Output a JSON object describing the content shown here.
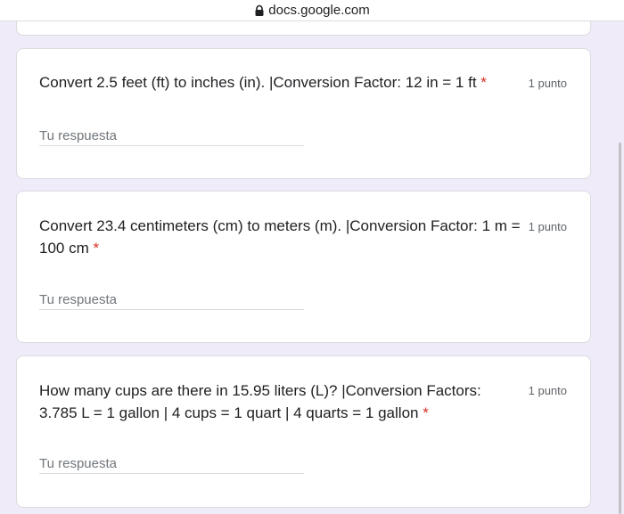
{
  "browser": {
    "url": "docs.google.com"
  },
  "questions": [
    {
      "title": "Convert 2.5 feet (ft) to inches (in). |Conversion Factor: 12 in = 1 ft",
      "required_mark": "*",
      "points": "1 punto",
      "answer_placeholder": "Tu respuesta"
    },
    {
      "title": "Convert 23.4 centimeters (cm) to meters (m). |Conversion Factor: 1 m = 100 cm",
      "required_mark": "*",
      "points": "1 punto",
      "answer_placeholder": "Tu respuesta"
    },
    {
      "title": "How many cups are there in 15.95 liters (L)? |Conversion Factors: 3.785 L = 1 gallon | 4 cups = 1 quart | 4 quarts = 1 gallon",
      "required_mark": "*",
      "points": "1 punto",
      "answer_placeholder": "Tu respuesta"
    }
  ],
  "colors": {
    "page_background": "#f0ebf8",
    "required": "#d93025",
    "text": "#202124",
    "secondary_text": "#5f6368"
  }
}
